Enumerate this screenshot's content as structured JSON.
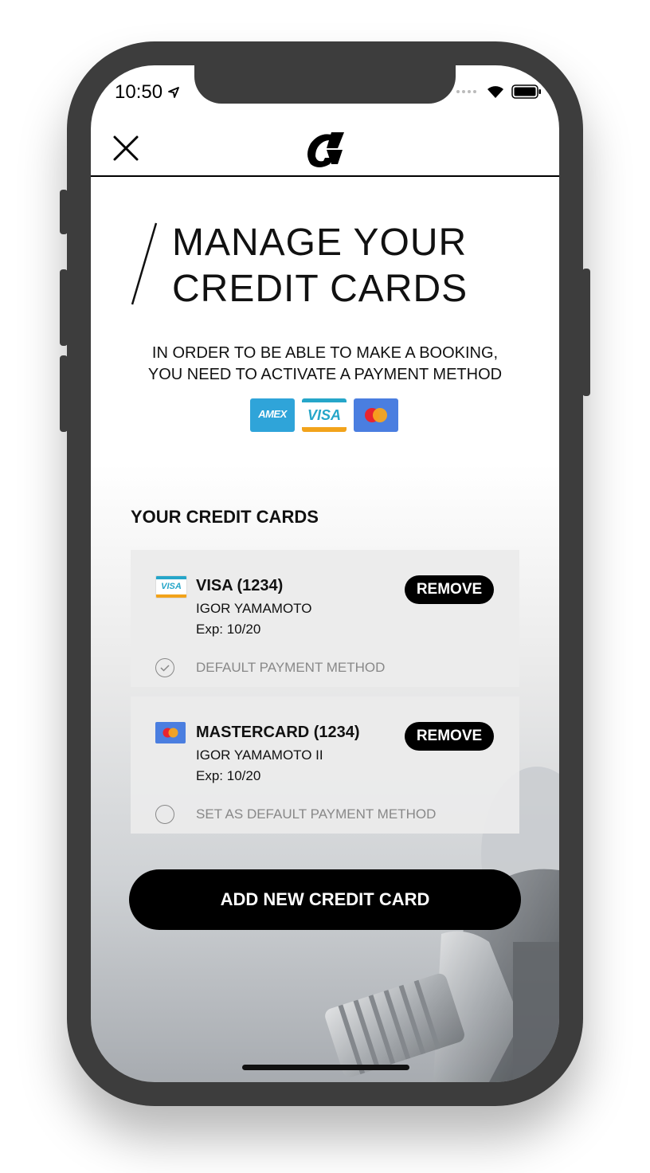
{
  "status_bar": {
    "time": "10:50"
  },
  "header": {
    "close_icon": "close-icon",
    "logo_icon": "brand-logo-icon"
  },
  "page": {
    "title_line1": "MANAGE YOUR",
    "title_line2": "CREDIT CARDS",
    "subtitle_line1": "IN ORDER TO BE ABLE TO MAKE A BOOKING,",
    "subtitle_line2": "YOU NEED TO ACTIVATE A PAYMENT METHOD"
  },
  "accepted_brands": [
    {
      "name": "AMEX",
      "label": "AMEX",
      "color": "#2fa4d9"
    },
    {
      "name": "VISA",
      "label": "VISA",
      "color": "#26a6c9"
    },
    {
      "name": "MASTERCARD",
      "color": "#4a7ee0"
    }
  ],
  "cards_section": {
    "title": "YOUR CREDIT CARDS",
    "cards": [
      {
        "name": "VISA (1234)",
        "holder": "IGOR YAMAMOTO",
        "exp": "Exp: 10/20",
        "remove_label": "REMOVE",
        "default_label": "DEFAULT PAYMENT METHOD",
        "is_default": true,
        "icon": "visa-icon"
      },
      {
        "name": "MASTERCARD (1234)",
        "holder": "IGOR YAMAMOTO II",
        "exp": "Exp: 10/20",
        "remove_label": "REMOVE",
        "default_label": "SET AS DEFAULT PAYMENT METHOD",
        "is_default": false,
        "icon": "mastercard-icon"
      }
    ]
  },
  "add_button_label": "ADD NEW CREDIT CARD",
  "colors": {
    "accent": "#000000",
    "screen_bg": "#ffffff",
    "device": "#3d3d3d"
  }
}
